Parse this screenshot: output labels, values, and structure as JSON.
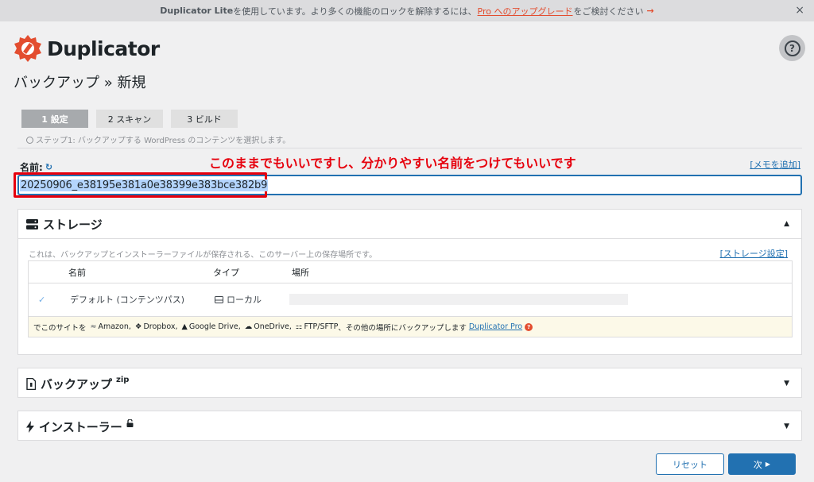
{
  "notice": {
    "product": "Duplicator Lite",
    "text_before": "を使用しています。より多くの機能のロックを解除するには、",
    "upgrade_link": "Pro へのアップグレード",
    "text_after": "をご検討ください",
    "arrow": "→",
    "close": "×"
  },
  "header": {
    "brand": "Duplicator",
    "help": "?",
    "page_title": "バックアップ » 新規"
  },
  "steps": [
    {
      "label": "1 設定",
      "active": true
    },
    {
      "label": "2 スキャン",
      "active": false
    },
    {
      "label": "3 ビルド",
      "active": false
    }
  ],
  "step_description": "ステップ1: バックアップする WordPress のコンテンツを選択します。",
  "name_field": {
    "label": "名前:",
    "refresh": "↻",
    "value": "20250906_e38195e381a0e38399e383bce382b9",
    "memo_link": "[メモを追加]"
  },
  "annotation": "このままでもいいですし、分かりやすい名前をつけてもいいです",
  "storage": {
    "title": "ストレージ",
    "caret": "▲",
    "description": "これは、バックアップとインストーラーファイルが保存される、このサーバー上の保存場所です。",
    "settings_link": "[ストレージ設定]",
    "columns": [
      "名前",
      "タイプ",
      "場所"
    ],
    "row": {
      "checked": "✓",
      "name": "デフォルト (コンテンツパス)",
      "type": "ローカル"
    },
    "promo": {
      "prefix": "でこのサイトを",
      "services": [
        "Amazon",
        "Dropbox",
        "Google Drive",
        "OneDrive",
        "FTP/SFTP"
      ],
      "suffix": "その他の場所にバックアップします",
      "pro_link": "Duplicator Pro",
      "help": "?"
    }
  },
  "backup_panel": {
    "title": "バックアップ",
    "sup": "zip",
    "caret": "▼"
  },
  "installer_panel": {
    "title": "インストーラー",
    "caret": "▼"
  },
  "buttons": {
    "reset": "リセット",
    "next": "次",
    "next_arrow": "▶"
  },
  "colors": {
    "brand": "#e34d2f",
    "accent": "#2271b1",
    "annotation": "#e6000d"
  }
}
